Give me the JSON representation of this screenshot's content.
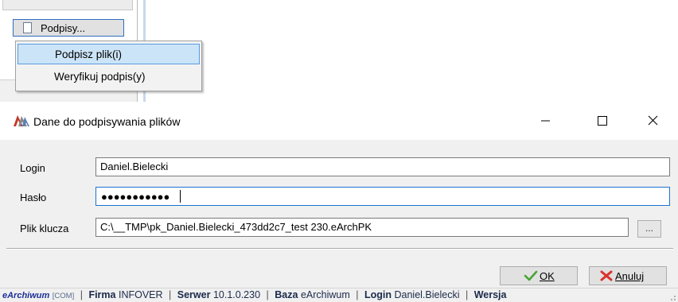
{
  "menu_fragment": {
    "podpisy_button_label": "Podpisy...",
    "items": [
      {
        "label": "Podpisz plik(i)",
        "highlighted": true
      },
      {
        "label": "Weryfikuj podpis(y)",
        "highlighted": false
      }
    ]
  },
  "dialog": {
    "title": "Dane do podpisywania plików",
    "login_label": "Login",
    "login_value": "Daniel.Bielecki",
    "password_label": "Hasło",
    "password_mask": "●●●●●●●●●●●",
    "key_label": "Plik klucza",
    "key_value": "C:\\__TMP\\pk_Daniel.Bielecki_473dd2c7_test 230.eArchPK",
    "browse_label": "...",
    "ok_label": "OK",
    "cancel_label": "Anuluj",
    "window_buttons": {
      "minimize": "minimize-icon",
      "maximize": "maximize-icon",
      "close": "close-icon"
    }
  },
  "statusbar": {
    "brand": "eArchiwum",
    "brand_suffix": "[COM]",
    "firma_label": "Firma",
    "firma_value": "INFOVER",
    "serwer_label": "Serwer",
    "serwer_value": "10.1.0.230",
    "baza_label": "Baza",
    "baza_value": "eArchiwum",
    "login_label": "Login",
    "login_value": "Daniel.Bielecki",
    "wersja_label": "Wersja"
  },
  "colors": {
    "menu_highlight": "#cce4f7",
    "focus_border": "#1873d3",
    "ok_check": "#4aa335",
    "cancel_x": "#d9342b"
  }
}
